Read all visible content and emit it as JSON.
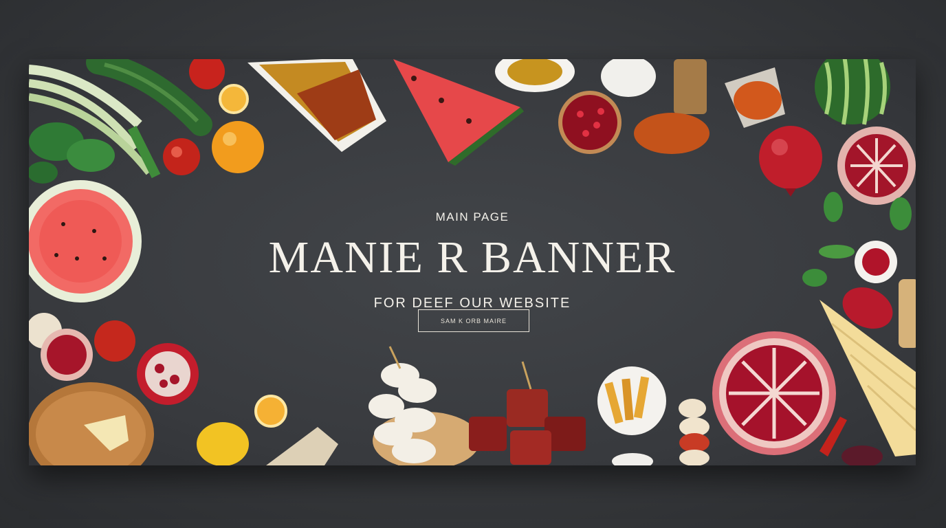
{
  "banner": {
    "eyebrow": "MAIN PAGE",
    "headline": "MANIE R BANNER",
    "subheadline": "FOR DEEF OUR WEBSITE",
    "cta_label": "SAM K ORB MAIRE"
  },
  "decor": {
    "items": [
      "scallion-icon",
      "zucchini-icon",
      "apple-icon",
      "lemon-slice-icon",
      "orange-icon",
      "spice-tray-icon",
      "watermelon-slice-icon",
      "dried-fruit-bowl-icon",
      "cheese-icon",
      "pomegranate-bowl-icon",
      "spice-jar-icon",
      "spice-powder-icon",
      "watermelon-icon",
      "pomegranate-icon",
      "herbs-icon",
      "cutting-board-icon",
      "macaron-stack-icon",
      "meat-skewer-icon",
      "fries-bowl-icon",
      "cheese-wedge-icon",
      "chili-icon"
    ]
  }
}
